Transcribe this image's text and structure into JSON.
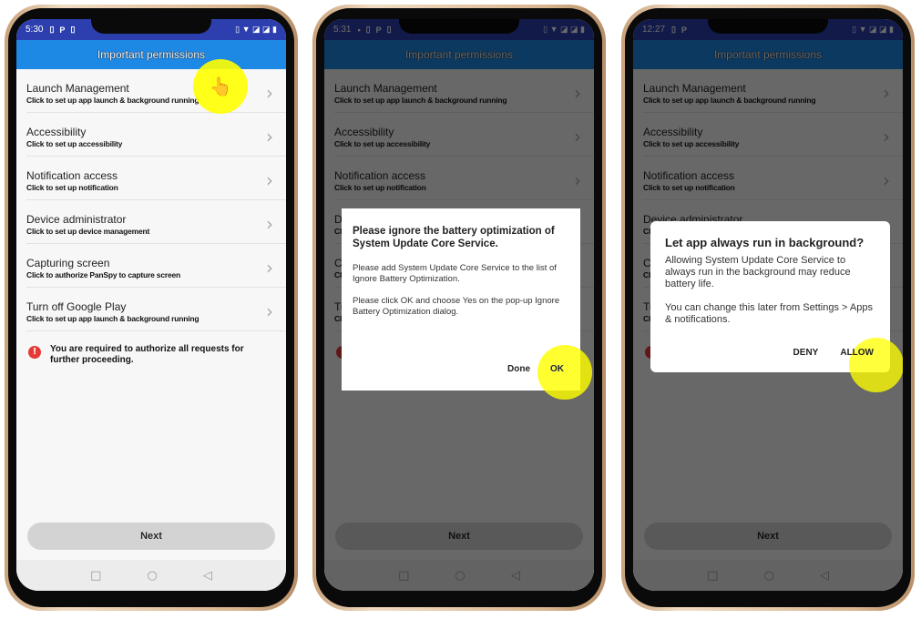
{
  "phones": [
    {
      "time": "5:30",
      "status_left": [
        "▯",
        "P",
        "▯"
      ],
      "dialog": null
    },
    {
      "time": "5:31",
      "status_left": [
        "▪",
        "▯",
        "P",
        "▯"
      ],
      "dialog": "battery"
    },
    {
      "time": "12:27",
      "status_left": [
        "▯",
        "P"
      ],
      "dialog": "background"
    }
  ],
  "status_right": "▯ ▼ ◪ ◪ ▮",
  "header": {
    "title": "Important permissions"
  },
  "rows": [
    {
      "title": "Launch Management",
      "subtitle": "Click to set up app launch & background running"
    },
    {
      "title": "Accessibility",
      "subtitle": "Click to set up accessibility"
    },
    {
      "title": "Notification access",
      "subtitle": "Click to set up notification"
    },
    {
      "title": "Device administrator",
      "subtitle": "Click to set up device management"
    },
    {
      "title": "Capturing screen",
      "subtitle": "Click to authorize PanSpy to capture screen"
    },
    {
      "title": "Turn off Google Play",
      "subtitle": "Click to set up app launch & background running"
    }
  ],
  "warning": "You are required to authorize all requests for further proceeding.",
  "next_label": "Next",
  "battery_dialog": {
    "title": "Please ignore the battery optimization of System Update Core Service.",
    "p1": "Please add System Update Core Service to the list of Ignore Battery Optimization.",
    "p2": "Please click OK and choose Yes on the pop-up Ignore Battery Optimization dialog.",
    "done": "Done",
    "ok": "OK"
  },
  "background_dialog": {
    "title": "Let app always run in background?",
    "p1": "Allowing System Update Core Service to always run in the background may reduce battery life.",
    "p2": "You can change this later from Settings > Apps & notifications.",
    "deny": "DENY",
    "allow": "ALLOW"
  },
  "highlight_color": "#ffff00",
  "accent_color": "#1e88e5"
}
